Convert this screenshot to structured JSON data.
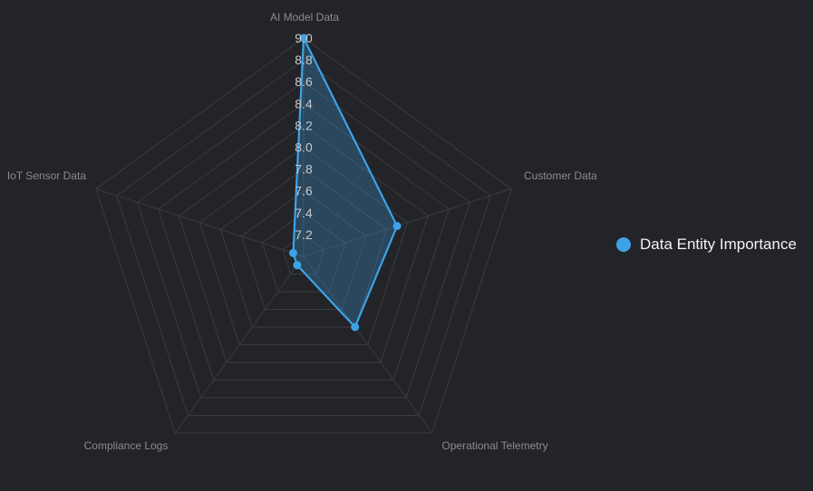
{
  "chart_data": {
    "type": "radar",
    "title": "",
    "indicators": [
      "AI Model Data",
      "Customer Data",
      "Operational Telemetry",
      "Compliance Logs",
      "IoT Sensor Data"
    ],
    "series": [
      {
        "name": "Data Entity Importance",
        "values": [
          9.0,
          7.9,
          7.8,
          7.1,
          7.1
        ],
        "color": "#3ca3e8"
      }
    ],
    "radial_range": [
      7.0,
      9.0
    ],
    "ticks": [
      "7.2",
      "7.4",
      "7.6",
      "7.8",
      "8.0",
      "8.2",
      "8.4",
      "8.6",
      "8.8",
      "9.0"
    ],
    "grid": true,
    "legend_position": "right"
  },
  "colors": {
    "background": "#232428",
    "grid": "#3a3b40",
    "series": "#3ca3e8"
  }
}
